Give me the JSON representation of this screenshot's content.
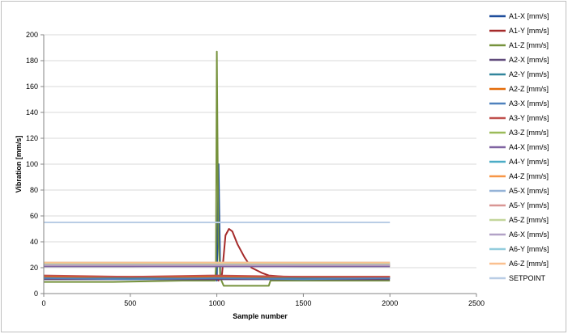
{
  "chart_data": {
    "type": "line",
    "xlabel": "Sample number",
    "ylabel": "Vibration [mm/s]",
    "xlim": [
      0,
      2500
    ],
    "ylim": [
      0,
      200
    ],
    "xticks": [
      0,
      500,
      1000,
      1500,
      2000,
      2500
    ],
    "yticks": [
      0,
      20,
      40,
      60,
      80,
      100,
      120,
      140,
      160,
      180,
      200
    ],
    "grid": "horizontal",
    "legend_position": "right",
    "series": [
      {
        "name": "A1-X [mm/s]",
        "color": "#1f4e9c",
        "x": [
          0,
          400,
          800,
          990,
          1000,
          1010,
          1020,
          1100,
          1500,
          2000
        ],
        "y": [
          12,
          12,
          12,
          12,
          10,
          100,
          12,
          12,
          12,
          12
        ]
      },
      {
        "name": "A1-Y [mm/s]",
        "color": "#a52a2a",
        "x": [
          0,
          500,
          990,
          1000,
          1010,
          1030,
          1050,
          1070,
          1090,
          1120,
          1160,
          1200,
          1260,
          1300,
          1400,
          1500,
          2000
        ],
        "y": [
          13,
          13,
          13,
          12,
          10,
          15,
          45,
          50,
          48,
          38,
          28,
          20,
          16,
          14,
          13,
          13,
          13
        ]
      },
      {
        "name": "A1-Z [mm/s]",
        "color": "#76923c",
        "x": [
          0,
          400,
          800,
          990,
          995,
          1000,
          1005,
          1010,
          1020,
          1040,
          1060,
          1200,
          1300,
          1310,
          1500,
          2000
        ],
        "y": [
          9,
          9,
          10,
          10,
          20,
          187,
          100,
          40,
          12,
          6,
          6,
          6,
          6,
          10,
          10,
          10
        ]
      },
      {
        "name": "A2-X [mm/s]",
        "color": "#604a7b",
        "x": [
          0,
          1000,
          2000
        ],
        "y": [
          11,
          11,
          11
        ]
      },
      {
        "name": "A2-Y [mm/s]",
        "color": "#31859c",
        "x": [
          0,
          1000,
          2000
        ],
        "y": [
          12,
          12,
          12
        ]
      },
      {
        "name": "A2-Z [mm/s]",
        "color": "#e46c0a",
        "x": [
          0,
          1000,
          2000
        ],
        "y": [
          13,
          13,
          13
        ]
      },
      {
        "name": "A3-X [mm/s]",
        "color": "#4f81bd",
        "x": [
          0,
          500,
          1000,
          1500,
          2000
        ],
        "y": [
          12,
          11,
          12,
          11,
          12
        ]
      },
      {
        "name": "A3-Y [mm/s]",
        "color": "#c0504d",
        "x": [
          0,
          500,
          1000,
          1500,
          2000
        ],
        "y": [
          14,
          13,
          14,
          13,
          13
        ]
      },
      {
        "name": "A3-Z [mm/s]",
        "color": "#9bbb59",
        "x": [
          0,
          500,
          1000,
          1500,
          2000
        ],
        "y": [
          21,
          21,
          22,
          21,
          21
        ]
      },
      {
        "name": "A4-X [mm/s]",
        "color": "#8064a2",
        "x": [
          0,
          1000,
          2000
        ],
        "y": [
          21,
          21,
          21
        ]
      },
      {
        "name": "A4-Y [mm/s]",
        "color": "#4bacc6",
        "x": [
          0,
          1000,
          2000
        ],
        "y": [
          23,
          23,
          23
        ]
      },
      {
        "name": "A4-Z [mm/s]",
        "color": "#f79646",
        "x": [
          0,
          1000,
          2000
        ],
        "y": [
          22,
          22,
          22
        ]
      },
      {
        "name": "A5-X [mm/s]",
        "color": "#95b3d7",
        "x": [
          0,
          1000,
          2000
        ],
        "y": [
          23,
          23,
          23
        ]
      },
      {
        "name": "A5-Y [mm/s]",
        "color": "#d99694",
        "x": [
          0,
          1000,
          2000
        ],
        "y": [
          22,
          22,
          22
        ]
      },
      {
        "name": "A5-Z [mm/s]",
        "color": "#c3d69b",
        "x": [
          0,
          1000,
          2000
        ],
        "y": [
          23,
          23,
          23
        ]
      },
      {
        "name": "A6-X [mm/s]",
        "color": "#b2a2c7",
        "x": [
          0,
          1000,
          2000
        ],
        "y": [
          22,
          22,
          22
        ]
      },
      {
        "name": "A6-Y [mm/s]",
        "color": "#93cddd",
        "x": [
          0,
          1000,
          2000
        ],
        "y": [
          24,
          24,
          24
        ]
      },
      {
        "name": "A6-Z [mm/s]",
        "color": "#fac08f",
        "x": [
          0,
          1000,
          2000
        ],
        "y": [
          24,
          24,
          24
        ]
      },
      {
        "name": "SETPOINT",
        "color": "#b9cde5",
        "x": [
          0,
          2000
        ],
        "y": [
          55,
          55
        ]
      }
    ]
  }
}
